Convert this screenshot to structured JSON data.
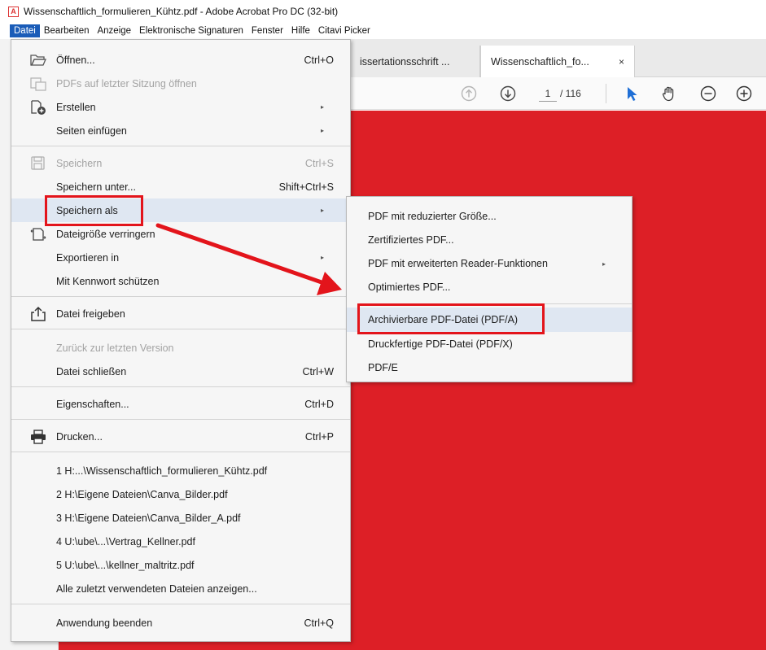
{
  "window": {
    "title": "Wissenschaftlich_formulieren_Kühtz.pdf - Adobe Acrobat Pro DC (32-bit)"
  },
  "menubar": [
    "Datei",
    "Bearbeiten",
    "Anzeige",
    "Elektronische Signaturen",
    "Fenster",
    "Hilfe",
    "Citavi Picker"
  ],
  "tabs": [
    {
      "label": "issertationsschrift ..."
    },
    {
      "label": "Wissenschaftlich_fo...",
      "close": "×"
    }
  ],
  "toolbar": {
    "current_page": "1",
    "total_pages": "/ 116"
  },
  "file_menu": {
    "open": {
      "label": "Öffnen...",
      "shortcut": "Ctrl+O"
    },
    "reopen": {
      "label": "PDFs auf letzter Sitzung öffnen"
    },
    "create": {
      "label": "Erstellen"
    },
    "insert": {
      "label": "Seiten einfügen"
    },
    "save": {
      "label": "Speichern",
      "shortcut": "Ctrl+S"
    },
    "save_under": {
      "label": "Speichern unter...",
      "shortcut": "Shift+Ctrl+S"
    },
    "save_as": {
      "label": "Speichern als"
    },
    "reduce": {
      "label": "Dateigröße verringern"
    },
    "export": {
      "label": "Exportieren in"
    },
    "password": {
      "label": "Mit Kennwort schützen"
    },
    "share": {
      "label": "Datei freigeben"
    },
    "revert": {
      "label": "Zurück zur letzten Version"
    },
    "close": {
      "label": "Datei schließen",
      "shortcut": "Ctrl+W"
    },
    "properties": {
      "label": "Eigenschaften...",
      "shortcut": "Ctrl+D"
    },
    "print": {
      "label": "Drucken...",
      "shortcut": "Ctrl+P"
    },
    "recent": [
      "1 H:...\\Wissenschaftlich_formulieren_Kühtz.pdf",
      "2 H:\\Eigene Dateien\\Canva_Bilder.pdf",
      "3 H:\\Eigene Dateien\\Canva_Bilder_A.pdf",
      "4 U:\\ube\\...\\Vertrag_Kellner.pdf",
      "5 U:\\ube\\...\\kellner_maltritz.pdf"
    ],
    "show_all_recent": {
      "label": "Alle zuletzt verwendeten Dateien anzeigen..."
    },
    "exit": {
      "label": "Anwendung beenden",
      "shortcut": "Ctrl+Q"
    }
  },
  "submenu": {
    "items": [
      "PDF mit reduzierter Größe...",
      "Zertifiziertes PDF...",
      "PDF mit erweiterten Reader-Funktionen",
      "Optimiertes PDF...",
      "Archivierbare PDF-Datei (PDF/A)",
      "Druckfertige PDF-Datei (PDF/X)",
      "PDF/E"
    ]
  },
  "colors": {
    "menu_active": "#1a5cb8",
    "highlight": "#dfe7f2",
    "annotation_red": "#e3141b",
    "document_red": "#dd1f26",
    "icon_blue": "#1f6fd6"
  }
}
